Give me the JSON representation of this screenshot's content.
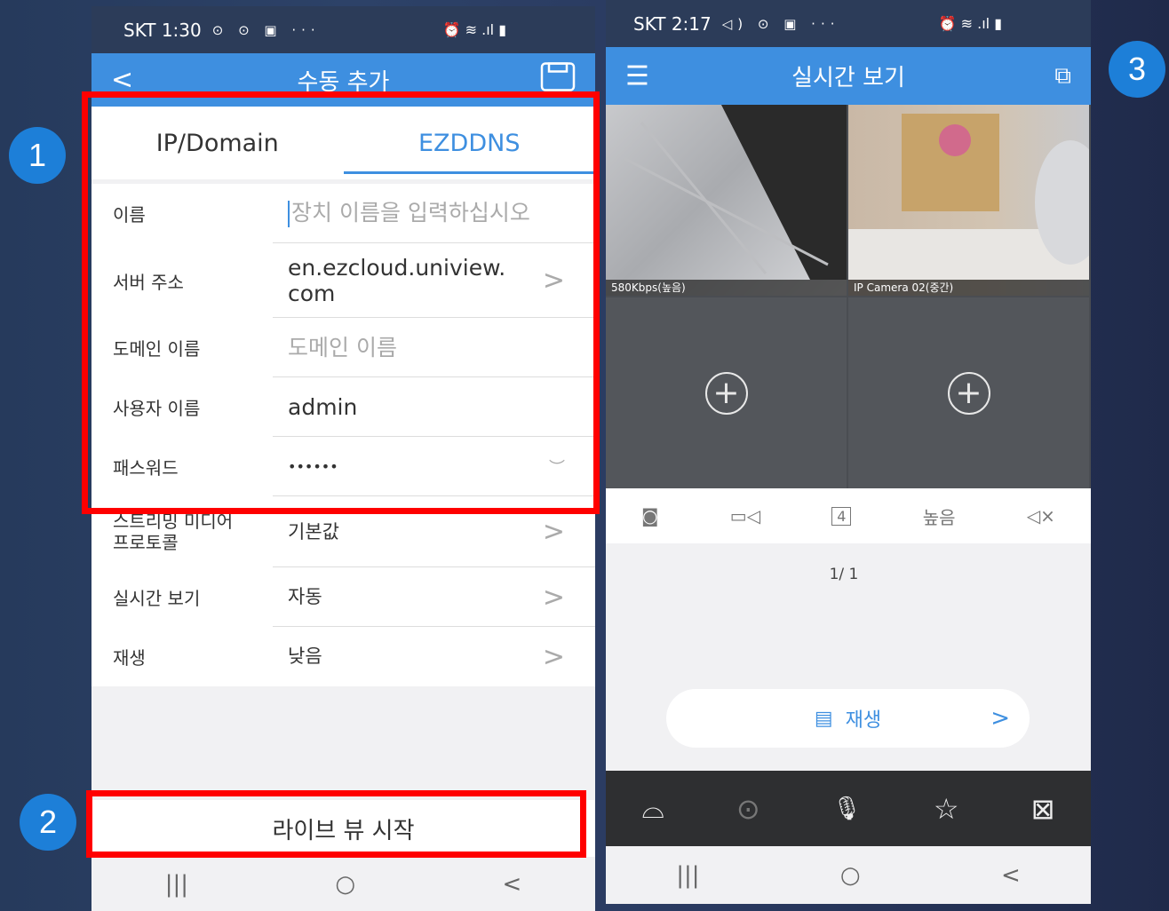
{
  "phone1": {
    "status": {
      "carrier_time": "SKT 1:30",
      "icons": "⊙ ⊙ ▣ ···",
      "right_icons": "⏰ ≋ .ıl ▮"
    },
    "nav": {
      "back": "<",
      "title": "수동 추가",
      "save": "⎙"
    },
    "tabs": [
      {
        "label": "IP/Domain"
      },
      {
        "label": "EZDDNS"
      }
    ],
    "rows": [
      {
        "label": "이름",
        "value": "장치 이름을 입력하십시오"
      },
      {
        "label": "서버 주소",
        "value": "en.ezcloud.uniview.\ncom"
      },
      {
        "label": "도메인 이름",
        "value": "도메인 이름"
      },
      {
        "label": "사용자 이름",
        "value": "admin"
      },
      {
        "label": "패스워드",
        "value": "••••••"
      },
      {
        "label": "스트리밍 미디어\n프로토콜",
        "value": "기본값"
      },
      {
        "label": "실시간 보기",
        "value": "자동"
      },
      {
        "label": "재생",
        "value": "낮음"
      }
    ],
    "live_button": "라이브 뷰 시작",
    "sysnav": {
      "recent": "|||",
      "home": "○",
      "back": "<"
    }
  },
  "phone2": {
    "status": {
      "carrier_time": "SKT 2:17",
      "icons": "◁) ⊙ ▣ ···",
      "right_icons": "⏰ ≋ .ıl ▮"
    },
    "nav": {
      "menu": "☰",
      "title": "실시간 보기",
      "cast": "⧉"
    },
    "cells": [
      {
        "caption": "580Kbps(높음)"
      },
      {
        "caption": "IP Camera 02(중간)"
      }
    ],
    "plus": "+",
    "toolbar": [
      {
        "icon": "camera-icon",
        "glyph": "◙"
      },
      {
        "icon": "record-icon",
        "glyph": "▭◁"
      },
      {
        "icon": "layout-icon",
        "glyph": "4"
      },
      {
        "icon": "quality",
        "glyph": "높음"
      },
      {
        "icon": "mute-icon",
        "glyph": "◁×"
      }
    ],
    "page_info": "1/ 1",
    "playback": {
      "label": "재생",
      "icon": "▤",
      "chev": ">"
    },
    "bottom": [
      {
        "icon": "ptz-dome-icon",
        "glyph": "⌓"
      },
      {
        "icon": "ptz-direction-icon",
        "glyph": "⊙"
      },
      {
        "icon": "mic-off-icon",
        "glyph": "🎙"
      },
      {
        "icon": "favorite-layout-icon",
        "glyph": "☆"
      },
      {
        "icon": "close-all-icon",
        "glyph": "⊠"
      }
    ],
    "sysnav": {
      "recent": "|||",
      "home": "○",
      "back": "<"
    }
  },
  "badges": {
    "one": "1",
    "two": "2",
    "three": "3"
  },
  "colors": {
    "accent": "#3e8fe0",
    "highlight": "#ff0000",
    "badge": "#1d7fd8"
  }
}
